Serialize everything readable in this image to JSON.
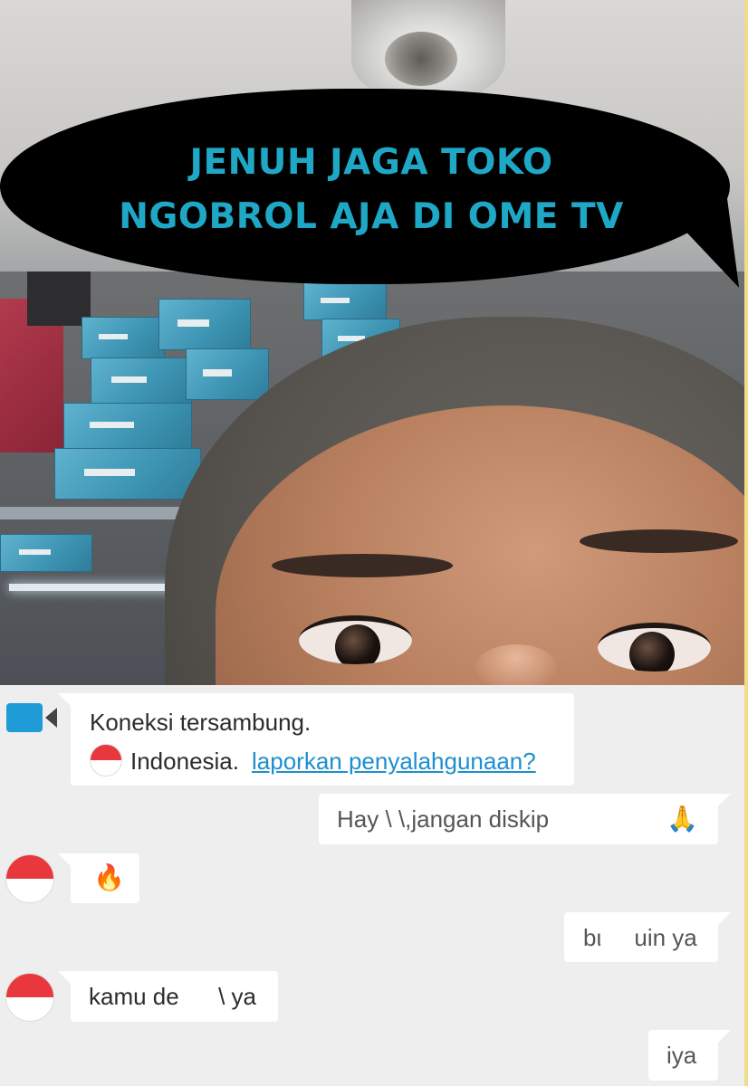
{
  "overlay": {
    "headline_line1": "JENUH JAGA TOKO",
    "headline_line2": "NGOBROL AJA DI OME TV",
    "headline_color": "#1fa7c6",
    "bubble_color": "#000000"
  },
  "chat": {
    "system": {
      "status": "Koneksi tersambung.",
      "country": "Indonesia.",
      "report_link": "laporkan penyalahgunaan?",
      "icon": "video-camera-icon",
      "link_color": "#1d8fcf"
    },
    "messages": [
      {
        "side": "right",
        "text": "Hay \\           \\,jangan diskip",
        "emoji": "🙏"
      },
      {
        "side": "left",
        "flag": "indonesia-flag-icon",
        "emoji": "🔥"
      },
      {
        "side": "right",
        "text": "bι     uin ya"
      },
      {
        "side": "left",
        "flag": "indonesia-flag-icon",
        "text": "kamu de      \\ ya"
      },
      {
        "side": "right",
        "text": "iya"
      }
    ]
  },
  "colors": {
    "chat_background": "#eeeeee",
    "bubble_background": "#ffffff",
    "camera_icon": "#1f9bd7",
    "flag_red": "#e8373d",
    "flag_white": "#ffffff"
  }
}
